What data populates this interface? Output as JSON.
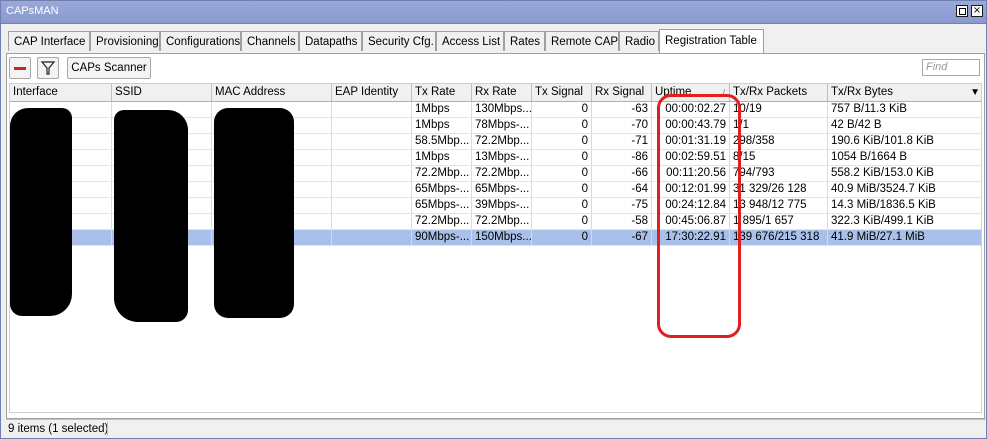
{
  "window": {
    "title": "CAPsMAN"
  },
  "tabs": [
    {
      "label": "CAP Interface"
    },
    {
      "label": "Provisioning"
    },
    {
      "label": "Configurations"
    },
    {
      "label": "Channels"
    },
    {
      "label": "Datapaths"
    },
    {
      "label": "Security Cfg."
    },
    {
      "label": "Access List"
    },
    {
      "label": "Rates"
    },
    {
      "label": "Remote CAP"
    },
    {
      "label": "Radio"
    },
    {
      "label": "Registration Table",
      "active": true
    }
  ],
  "toolbar": {
    "remove_icon": "minus-icon",
    "filter_icon": "filter-icon",
    "scanner_label": "CAPs Scanner",
    "find_placeholder": "Find"
  },
  "table": {
    "columns": [
      "Interface",
      "SSID",
      "MAC Address",
      "EAP Identity",
      "Tx Rate",
      "Rx Rate",
      "Tx Signal",
      "Rx Signal",
      "Uptime",
      "Tx/Rx Packets",
      "Tx/Rx Bytes"
    ],
    "sorted_column": "Uptime",
    "rows": [
      {
        "tx_rate": "1Mbps",
        "rx_rate": "130Mbps...",
        "tx_signal": "0",
        "rx_signal": "-63",
        "uptime": "00:00:02.27",
        "packets": "10/19",
        "bytes": "757 B/11.3 KiB"
      },
      {
        "tx_rate": "1Mbps",
        "rx_rate": "78Mbps-...",
        "tx_signal": "0",
        "rx_signal": "-70",
        "uptime": "00:00:43.79",
        "packets": "1/1",
        "bytes": "42 B/42 B"
      },
      {
        "tx_rate": "58.5Mbp...",
        "rx_rate": "72.2Mbp...",
        "tx_signal": "0",
        "rx_signal": "-71",
        "uptime": "00:01:31.19",
        "packets": "298/358",
        "bytes": "190.6 KiB/101.8 KiB"
      },
      {
        "tx_rate": "1Mbps",
        "rx_rate": "13Mbps-...",
        "tx_signal": "0",
        "rx_signal": "-86",
        "uptime": "00:02:59.51",
        "packets": "8/15",
        "bytes": "1054 B/1664 B"
      },
      {
        "tx_rate": "72.2Mbp...",
        "rx_rate": "72.2Mbp...",
        "tx_signal": "0",
        "rx_signal": "-66",
        "uptime": "00:11:20.56",
        "packets": "794/793",
        "bytes": "558.2 KiB/153.0 KiB"
      },
      {
        "tx_rate": "65Mbps-...",
        "rx_rate": "65Mbps-...",
        "tx_signal": "0",
        "rx_signal": "-64",
        "uptime": "00:12:01.99",
        "packets": "31 329/26 128",
        "bytes": "40.9 MiB/3524.7 KiB"
      },
      {
        "tx_rate": "65Mbps-...",
        "rx_rate": "39Mbps-...",
        "tx_signal": "0",
        "rx_signal": "-75",
        "uptime": "00:24:12.84",
        "packets": "13 948/12 775",
        "bytes": "14.3 MiB/1836.5 KiB"
      },
      {
        "tx_rate": "72.2Mbp...",
        "rx_rate": "72.2Mbp...",
        "tx_signal": "0",
        "rx_signal": "-58",
        "uptime": "00:45:06.87",
        "packets": "1 895/1 657",
        "bytes": "322.3 KiB/499.1 KiB"
      },
      {
        "tx_rate": "90Mbps-...",
        "rx_rate": "150Mbps...",
        "tx_signal": "0",
        "rx_signal": "-67",
        "uptime": "17:30:22.91",
        "packets": "139 676/215 318",
        "bytes": "41.9 MiB/27.1 MiB",
        "selected": true
      }
    ]
  },
  "status": {
    "text": "9 items (1 selected)"
  },
  "colors": {
    "highlight": "#e02020",
    "selection": "#a9c1e9",
    "title_bar": "#8a99cf"
  }
}
